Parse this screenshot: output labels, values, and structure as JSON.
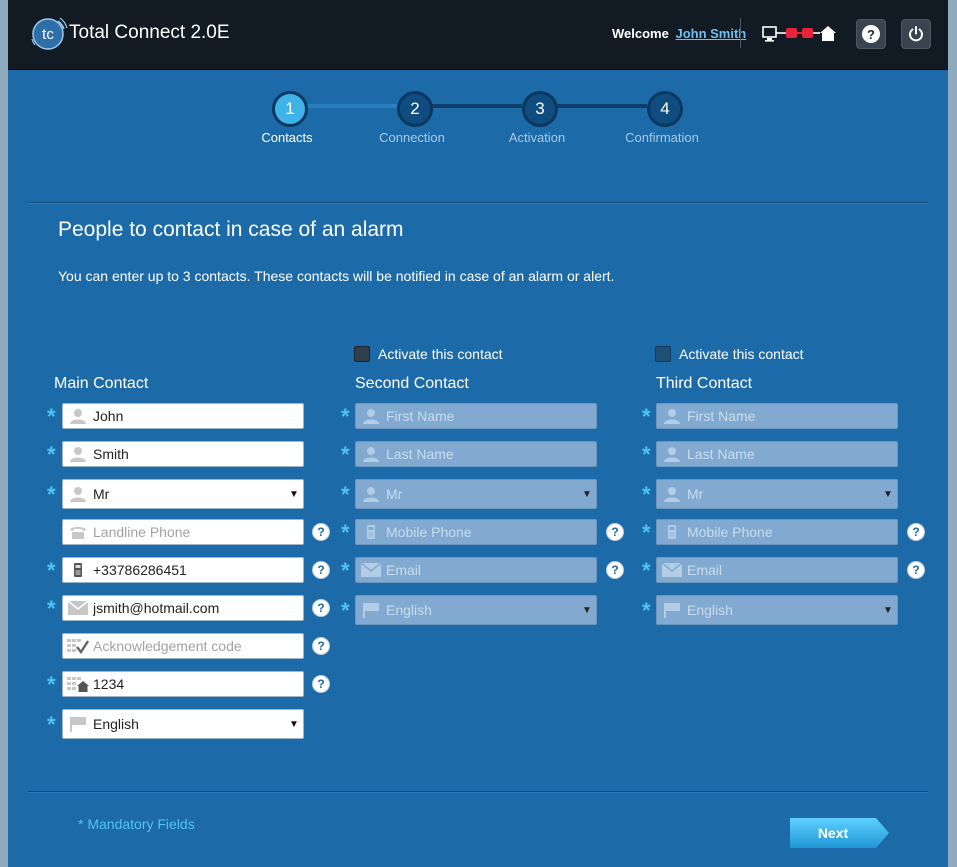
{
  "header": {
    "app_title": "Total Connect 2.0E",
    "logo_text": "tc",
    "welcome_label": "Welcome",
    "user_name": "John Smith",
    "help_label": "?",
    "connection_color_bad": "#e8233a"
  },
  "steps": [
    {
      "number": "1",
      "label": "Contacts",
      "active": true
    },
    {
      "number": "2",
      "label": "Connection",
      "active": false
    },
    {
      "number": "3",
      "label": "Activation",
      "active": false
    },
    {
      "number": "4",
      "label": "Confirmation",
      "active": false
    }
  ],
  "page": {
    "heading": "People to contact in case of an alarm",
    "intro": "You can enter up to 3 contacts. These contacts will be notified in case of an alarm or alert.",
    "activate_label": "Activate this contact",
    "mandatory_note": "* Mandatory Fields",
    "next_label": "Next"
  },
  "main_contact": {
    "title": "Main Contact",
    "first_name": "John",
    "last_name": "Smith",
    "salutation": "Mr",
    "landline_placeholder": "Landline Phone",
    "mobile": "+33786286451",
    "email": "jsmith@hotmail.com",
    "ack_placeholder": "Acknowledgement code",
    "code": "1234",
    "language": "English"
  },
  "second_contact": {
    "title": "Second Contact",
    "first_name_placeholder": "First Name",
    "last_name_placeholder": "Last Name",
    "salutation": "Mr",
    "mobile_placeholder": "Mobile Phone",
    "email_placeholder": "Email",
    "language": "English"
  },
  "third_contact": {
    "title": "Third Contact",
    "first_name_placeholder": "First Name",
    "last_name_placeholder": "Last Name",
    "salutation": "Mr",
    "mobile_placeholder": "Mobile Phone",
    "email_placeholder": "Email",
    "language": "English"
  }
}
